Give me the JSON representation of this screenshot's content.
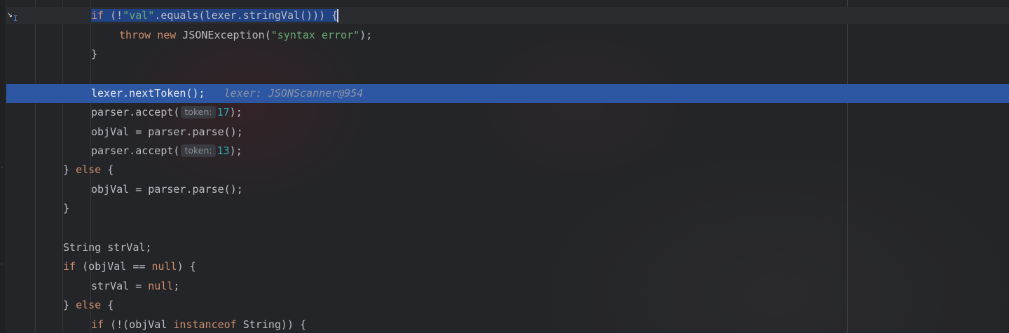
{
  "editor": {
    "lines": [
      {
        "id": "l1",
        "indent": 2,
        "tokens": [
          {
            "t": "if",
            "c": "kw"
          },
          {
            "t": " (!"
          },
          {
            "t": "\"val\"",
            "c": "str"
          },
          {
            "t": ".equals(lexer.stringVal())) {"
          }
        ]
      },
      {
        "id": "l2",
        "indent": 3,
        "tokens": [
          {
            "t": "throw",
            "c": "kw"
          },
          {
            "t": " "
          },
          {
            "t": "new",
            "c": "kw"
          },
          {
            "t": " JSONException("
          },
          {
            "t": "\"syntax error\"",
            "c": "str"
          },
          {
            "t": ");"
          }
        ]
      },
      {
        "id": "l3",
        "indent": 2,
        "tokens": [
          {
            "t": "}"
          }
        ]
      },
      {
        "id": "l4",
        "indent": 0,
        "tokens": []
      },
      {
        "id": "l5",
        "indent": 2,
        "tokens": [
          {
            "t": "lexer.nextToken();"
          }
        ],
        "debug": "lexer: JSONScanner@954"
      },
      {
        "id": "l6",
        "indent": 2,
        "tokens": [
          {
            "t": "parser.accept("
          },
          {
            "hint": "token:"
          },
          {
            "t": "17",
            "c": "num"
          },
          {
            "t": ");"
          }
        ]
      },
      {
        "id": "l7",
        "indent": 2,
        "tokens": [
          {
            "t": "objVal = parser.parse();"
          }
        ]
      },
      {
        "id": "l8",
        "indent": 2,
        "tokens": [
          {
            "t": "parser.accept("
          },
          {
            "hint": "token:"
          },
          {
            "t": "13",
            "c": "num"
          },
          {
            "t": ");"
          }
        ]
      },
      {
        "id": "l9",
        "indent": 1,
        "tokens": [
          {
            "t": "} "
          },
          {
            "t": "else",
            "c": "kw"
          },
          {
            "t": " {"
          }
        ]
      },
      {
        "id": "l10",
        "indent": 2,
        "tokens": [
          {
            "t": "objVal = parser.parse();"
          }
        ]
      },
      {
        "id": "l11",
        "indent": 1,
        "tokens": [
          {
            "t": "}"
          }
        ]
      },
      {
        "id": "l12",
        "indent": 0,
        "tokens": []
      },
      {
        "id": "l13",
        "indent": 1,
        "tokens": [
          {
            "t": "String strVal;"
          }
        ]
      },
      {
        "id": "l14",
        "indent": 1,
        "tokens": [
          {
            "t": "if",
            "c": "kw"
          },
          {
            "t": " (objVal == "
          },
          {
            "t": "null",
            "c": "kw"
          },
          {
            "t": ") {"
          }
        ]
      },
      {
        "id": "l15",
        "indent": 2,
        "tokens": [
          {
            "t": "strVal = "
          },
          {
            "t": "null",
            "c": "kw"
          },
          {
            "t": ";"
          }
        ]
      },
      {
        "id": "l16",
        "indent": 1,
        "tokens": [
          {
            "t": "} "
          },
          {
            "t": "else",
            "c": "kw"
          },
          {
            "t": " {"
          }
        ]
      },
      {
        "id": "l17",
        "indent": 2,
        "tokens": [
          {
            "t": "if",
            "c": "kw"
          },
          {
            "t": " (!(objVal "
          },
          {
            "t": "instanceof",
            "c": "kw"
          },
          {
            "t": " String)) {"
          }
        ]
      }
    ],
    "selected_line": "l1",
    "execution_line": "l5"
  },
  "icons": {
    "step_marker": "step-into-cursor-icon"
  },
  "colors": {
    "keyword": "#cf8e6d",
    "string": "#6aab73",
    "number": "#2aacb8",
    "text": "#bcbec4",
    "execution_highlight": "#2d56a3",
    "selection": "#214283"
  }
}
